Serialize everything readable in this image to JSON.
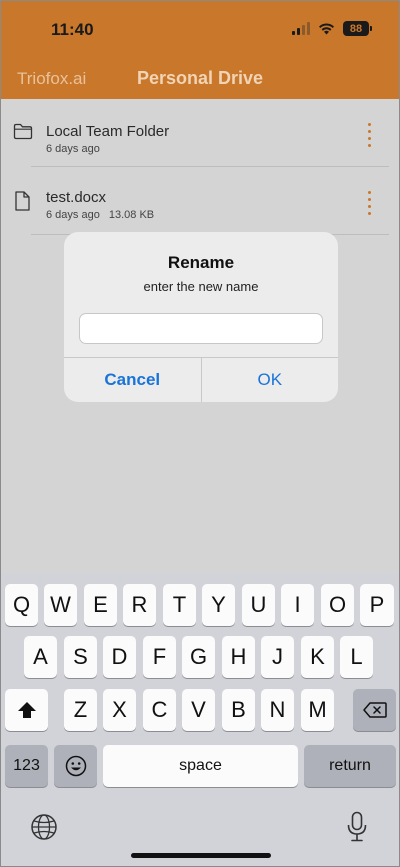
{
  "status": {
    "time": "11:40",
    "battery": "88"
  },
  "nav": {
    "left": "Triofox.ai",
    "title": "Personal Drive"
  },
  "files": [
    {
      "name": "Local Team Folder",
      "modified": "6 days ago",
      "size": "",
      "icon": "folder-icon"
    },
    {
      "name": "test.docx",
      "modified": "6 days ago",
      "size": "13.08 KB",
      "icon": "document-icon"
    }
  ],
  "dialog": {
    "title": "Rename",
    "message": "enter the new name",
    "input_value": "",
    "cancel_label": "Cancel",
    "ok_label": "OK"
  },
  "keyboard": {
    "row1": [
      "Q",
      "W",
      "E",
      "R",
      "T",
      "Y",
      "U",
      "I",
      "O",
      "P"
    ],
    "row2": [
      "A",
      "S",
      "D",
      "F",
      "G",
      "H",
      "J",
      "K",
      "L"
    ],
    "row3": [
      "Z",
      "X",
      "C",
      "V",
      "B",
      "N",
      "M"
    ],
    "numbers_label": "123",
    "space_label": "space",
    "return_label": "return"
  },
  "colors": {
    "accent": "#c9772b",
    "link": "#1a73d9"
  }
}
